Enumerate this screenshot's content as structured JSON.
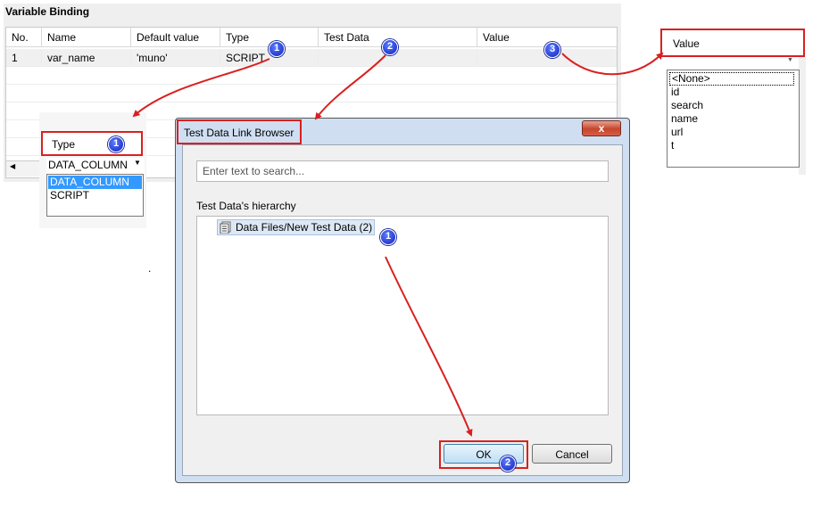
{
  "variable_binding": {
    "title": "Variable Binding",
    "columns": [
      "No.",
      "Name",
      "Default value",
      "Type",
      "Test Data",
      "Value"
    ],
    "rows": [
      {
        "no": "1",
        "name": "var_name",
        "default_value": "'muno'",
        "type": "SCRIPT",
        "test_data": "",
        "value": ""
      }
    ]
  },
  "type_popup": {
    "header": "Type",
    "selected": "DATA_COLUMN",
    "options": [
      "DATA_COLUMN",
      "SCRIPT"
    ]
  },
  "value_popup": {
    "header": "Value",
    "options": [
      "<None>",
      "id",
      "search",
      "name",
      "url",
      "t"
    ]
  },
  "dialog": {
    "title": "Test Data Link Browser",
    "close_label": "x",
    "search_placeholder": "Enter text to search...",
    "hierarchy_label": "Test Data's hierarchy",
    "tree_item": "Data Files/New Test Data (2)",
    "ok_label": "OK",
    "cancel_label": "Cancel"
  },
  "badges": {
    "top_1": "1",
    "top_2": "2",
    "top_3": "3",
    "type_1": "1",
    "tree_1": "1",
    "ok_2": "2"
  },
  "colors": {
    "highlight": "#d92020",
    "badge": "#1a2ad0",
    "selection": "#3399ff"
  },
  "stray_mark": "."
}
